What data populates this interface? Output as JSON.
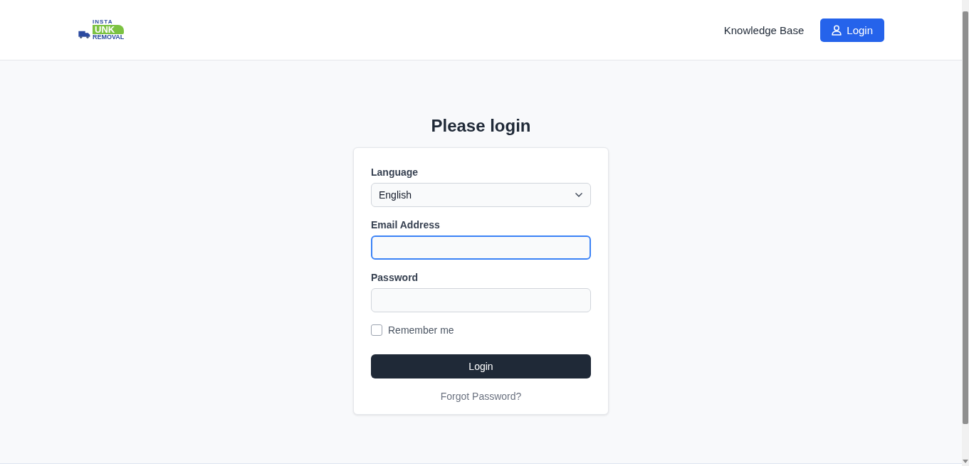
{
  "header": {
    "logo": {
      "top": "INSTA",
      "middle": "UNK",
      "bottom": "REMOVAL"
    },
    "nav_link": "Knowledge Base",
    "login_button": "Login"
  },
  "title": "Please login",
  "form": {
    "language": {
      "label": "Language",
      "value": "English"
    },
    "email": {
      "label": "Email Address",
      "focused": true
    },
    "password": {
      "label": "Password",
      "focused": false
    },
    "remember": {
      "label": "Remember me",
      "checked": false
    },
    "submit": "Login",
    "forgot": "Forgot Password?"
  }
}
